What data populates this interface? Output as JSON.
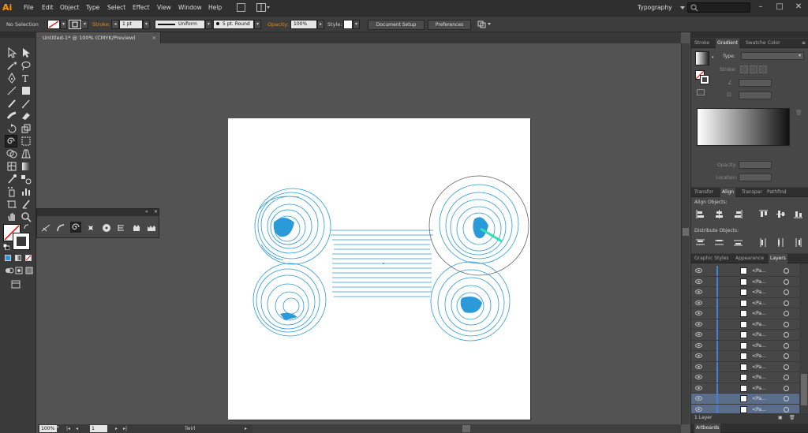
{
  "app": {
    "logo_text": "Ai",
    "workspace": "Typography"
  },
  "menu": [
    "File",
    "Edit",
    "Object",
    "Type",
    "Select",
    "Effect",
    "View",
    "Window",
    "Help"
  ],
  "controlbar": {
    "selection_status": "No Selection",
    "stroke_label": "Stroke:",
    "stroke_weight": "1 pt",
    "profile": "Uniform",
    "brush": "5 pt. Round",
    "opacity_label": "Opacity:",
    "opacity": "100%",
    "style_label": "Style:",
    "document_setup": "Document Setup",
    "preferences": "Preferences"
  },
  "document": {
    "tab_title": "Untitled-1* @ 100% (CMYK/Preview)",
    "close": "×"
  },
  "status": {
    "zoom": "100%",
    "artboard": "1",
    "tool": "Twirl"
  },
  "panels": {
    "gradient": {
      "tabs": [
        "Stroke",
        "Gradient",
        "Swatche",
        "Color"
      ],
      "active_tab": "Gradient",
      "type_label": "Type:",
      "stroke_label": "Stroke:",
      "opacity_label": "Opacity:",
      "location_label": "Location:"
    },
    "align": {
      "tabs": [
        "Transfor",
        "Align",
        "Transpar",
        "Pathfind"
      ],
      "active_tab": "Align",
      "align_objects_label": "Align Objects:",
      "distribute_objects_label": "Distribute Objects:"
    },
    "layers": {
      "tabs": [
        "Graphic Styles",
        "Appearance",
        "Layers"
      ],
      "active_tab": "Layers",
      "rows": [
        "<Pa...",
        "<Pa...",
        "<Pa...",
        "<Pa...",
        "<Pa...",
        "<Pa...",
        "<Pa...",
        "<Pa...",
        "<Pa...",
        "<Pa...",
        "<Pa...",
        "<Pa...",
        "<Pa...",
        "<Pa..."
      ],
      "footer": "1 Layer"
    },
    "artboards": {
      "tab": "Artboards"
    }
  },
  "colors": {
    "accent_blue": "#2a9ad8",
    "teal": "#31e0b8",
    "menubar": "#2f2f2f",
    "canvas": "#535353"
  }
}
